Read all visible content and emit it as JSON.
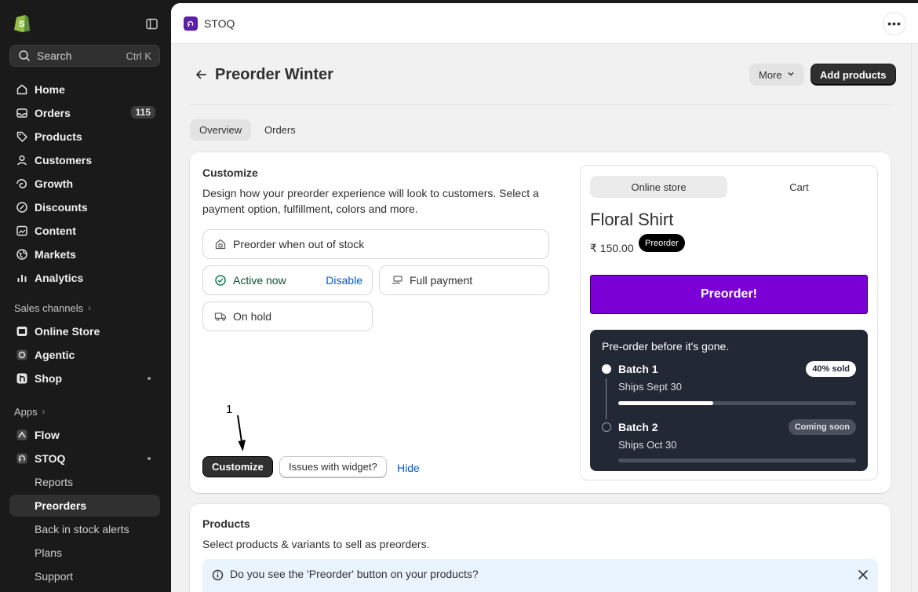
{
  "sidebar": {
    "search_text": "Search",
    "search_shortcut": "Ctrl K",
    "nav": [
      {
        "label": "Home",
        "icon": "home-icon"
      },
      {
        "label": "Orders",
        "icon": "inbox-icon",
        "badge": "115"
      },
      {
        "label": "Products",
        "icon": "tag-icon"
      },
      {
        "label": "Customers",
        "icon": "person-icon"
      },
      {
        "label": "Growth",
        "icon": "growth-icon"
      },
      {
        "label": "Discounts",
        "icon": "discount-icon"
      },
      {
        "label": "Content",
        "icon": "content-icon"
      },
      {
        "label": "Markets",
        "icon": "globe-icon"
      },
      {
        "label": "Analytics",
        "icon": "bar-chart-icon"
      }
    ],
    "sales_channels_label": "Sales channels",
    "channels": [
      {
        "label": "Online Store"
      },
      {
        "label": "Agentic"
      },
      {
        "label": "Shop"
      }
    ],
    "apps_label": "Apps",
    "apps": [
      {
        "label": "Flow"
      },
      {
        "label": "STOQ"
      }
    ],
    "stoq_sub": [
      {
        "label": "Reports"
      },
      {
        "label": "Preorders"
      },
      {
        "label": "Back in stock alerts"
      },
      {
        "label": "Plans"
      },
      {
        "label": "Support"
      }
    ]
  },
  "topbar": {
    "app_name": "STOQ",
    "dots": "•••"
  },
  "page": {
    "title": "Preorder Winter",
    "more_label": "More",
    "add_products_label": "Add products",
    "tabs": [
      {
        "label": "Overview",
        "active": true
      },
      {
        "label": "Orders",
        "active": false
      }
    ]
  },
  "customize": {
    "title": "Customize",
    "description": "Design how your preorder experience will look to customers. Select a payment option, fulfillment, colors and more.",
    "option_out_of_stock": "Preorder when out of stock",
    "option_active": "Active now",
    "option_disable": "Disable",
    "option_full_payment": "Full payment",
    "option_on_hold": "On hold",
    "annotation_number": "1",
    "customize_button": "Customize",
    "issues_button": "Issues with widget?",
    "hide_link": "Hide"
  },
  "preview": {
    "tab_online_store": "Online store",
    "tab_cart": "Cart",
    "product_name": "Floral Shirt",
    "price": "₹ 150.00",
    "badge": "Preorder",
    "cta": "Preorder!",
    "batch_heading": "Pre-order before it's gone.",
    "batches": [
      {
        "name": "Batch 1",
        "ships": "Ships Sept 30",
        "tag": "40% sold",
        "progress": 0.4
      },
      {
        "name": "Batch 2",
        "ships": "Ships Oct 30",
        "tag": "Coming soon",
        "progress": 0
      }
    ],
    "cta_color": "#7a00d6"
  },
  "products": {
    "title": "Products",
    "description": "Select products & variants to sell as preorders.",
    "banner_text": "Do you see the 'Preorder' button on your products?"
  }
}
